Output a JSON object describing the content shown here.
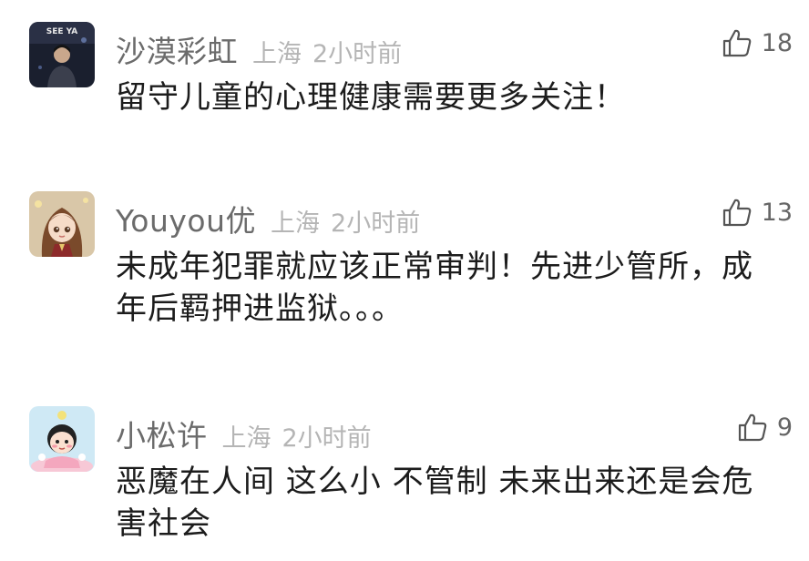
{
  "comments": [
    {
      "username": "沙漠彩虹",
      "location": "上海",
      "time": "2小时前",
      "likes": "18",
      "text": "留守儿童的心理健康需要更多关注！",
      "avatar_label": "SEE YA",
      "avatar_icon": "person-photo-avatar"
    },
    {
      "username": "Youyou优",
      "location": "上海",
      "time": "2小时前",
      "likes": "13",
      "text": "未成年犯罪就应该正常审判！先进少管所，成年后羁押进监狱。。。",
      "avatar_icon": "anime-girl-avatar"
    },
    {
      "username": "小松许",
      "location": "上海",
      "time": "2小时前",
      "likes": "9",
      "text": "恶魔在人间 这么小 不管制 未来出来还是会危害社会",
      "avatar_icon": "cartoon-baby-avatar"
    }
  ],
  "like_icon": "thumbs-up-icon",
  "colors": {
    "username": "#6b6b6b",
    "meta": "#b5b5b5",
    "text": "#1c1c1c"
  }
}
